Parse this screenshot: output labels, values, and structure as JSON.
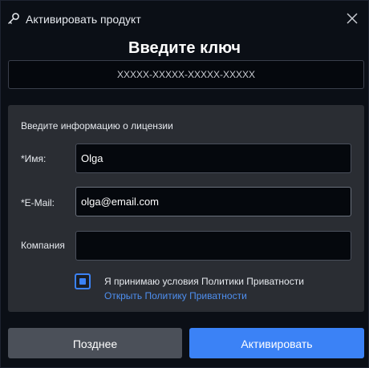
{
  "window": {
    "title": "Активировать продукт",
    "title_icon": "key-icon",
    "close_icon": "close-icon"
  },
  "heading": "Введите ключ",
  "key_field": {
    "placeholder": "XXXXX-XXXXX-XXXXX-XXXXX",
    "value": ""
  },
  "license_info": {
    "title": "Введите информацию о лицензии",
    "name_label": "*Имя:",
    "name_value": "Olga",
    "email_label": "*E-Mail:",
    "email_value": "olga@email.com",
    "company_label": "Компания",
    "company_value": ""
  },
  "consent": {
    "checked": true,
    "text": "Я принимаю условия Политики Приватности",
    "link": "Открыть Политику Приватности"
  },
  "buttons": {
    "later": "Позднее",
    "activate": "Активировать"
  },
  "colors": {
    "accent": "#3b82f6",
    "background": "#0b0f16",
    "panel": "#2a2d33",
    "link": "#4e8ff0"
  }
}
